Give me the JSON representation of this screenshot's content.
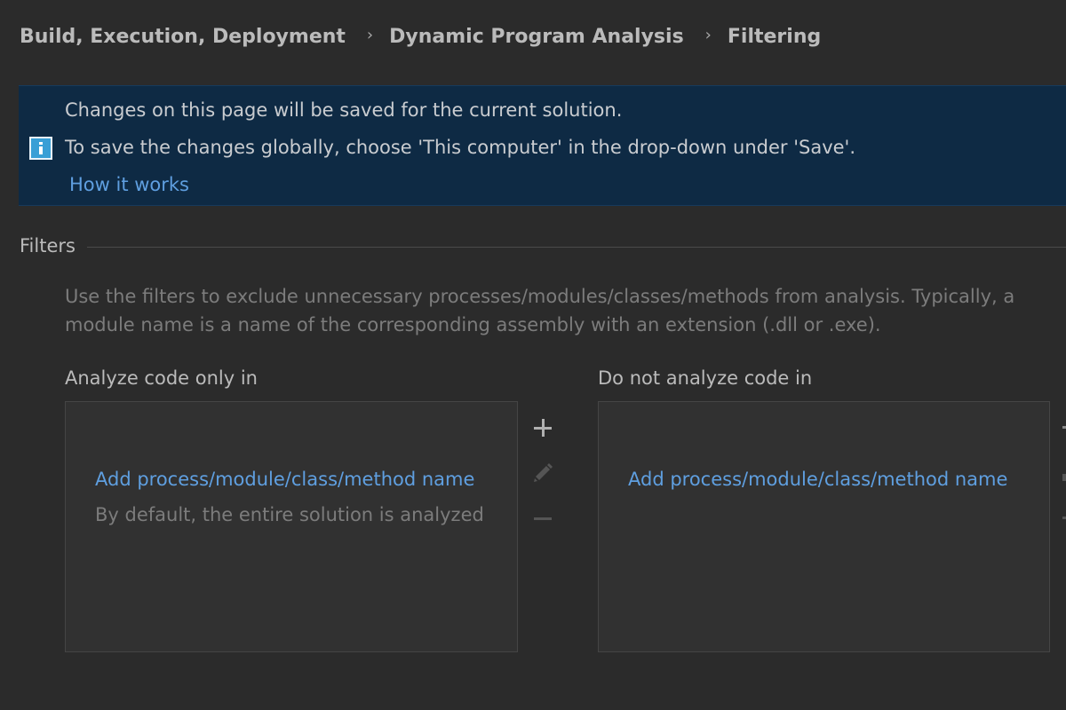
{
  "breadcrumb": {
    "items": [
      "Build, Execution, Deployment",
      "Dynamic Program Analysis",
      "Filtering"
    ],
    "separator": "›"
  },
  "info_banner": {
    "line1": "Changes on this page will be saved for the current solution.",
    "line2": "To save the changes globally, choose 'This computer' in the drop-down under 'Save'.",
    "link": "How it works",
    "icon": "info-icon"
  },
  "filters": {
    "section_title": "Filters",
    "description": "Use the filters to exclude unnecessary processes/modules/classes/methods from analysis. Typically, a module name is a name of the corresponding assembly with an extension (.dll or .exe).",
    "include_panel": {
      "label": "Analyze code only in",
      "add_link": "Add process/module/class/method name",
      "hint": "By default, the entire solution is analyzed"
    },
    "exclude_panel": {
      "label": "Do not analyze code in",
      "add_link": "Add process/module/class/method name"
    },
    "toolbar_icons": [
      "plus-icon",
      "pencil-icon",
      "minus-icon"
    ]
  },
  "colors": {
    "background": "#2b2b2b",
    "banner_background": "#0e2a44",
    "link": "#5f9fe0",
    "text": "#bbbbbb",
    "muted_text": "#7c7c7c",
    "info_icon": "#389fd6"
  }
}
